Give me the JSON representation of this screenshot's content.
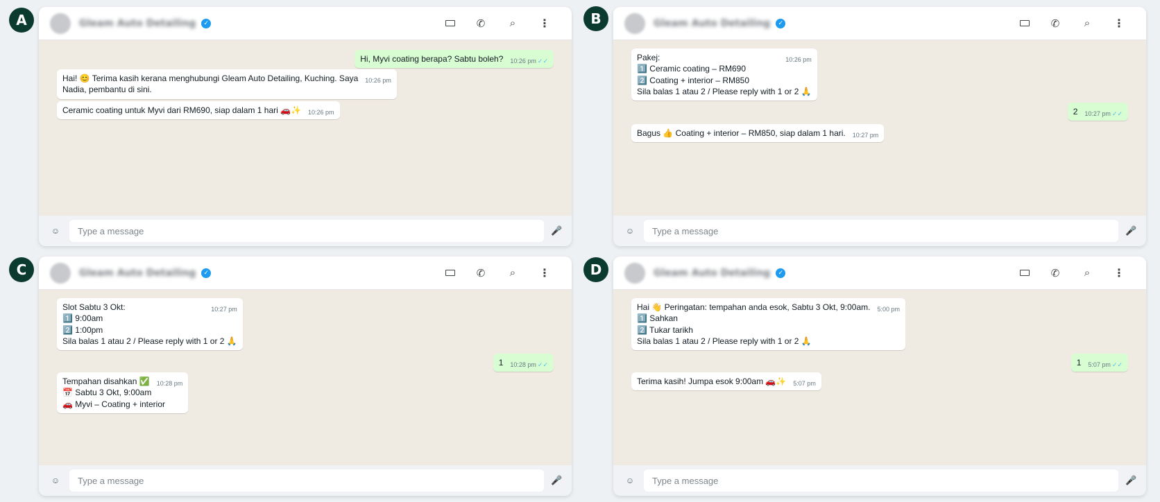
{
  "colors": {
    "label_bg": "#0b3b2e",
    "chat_bg": "#efeae2",
    "outgoing_bubble": "#d9fdd3",
    "incoming_bubble": "#ffffff",
    "verified_badge": "#1d9bf0",
    "read_ticks": "#53bdeb"
  },
  "icons": {
    "video": "video-icon",
    "call": "phone-icon",
    "search": "search-icon",
    "menu": "kebab-menu-icon",
    "emoji": "emoji-icon",
    "mic": "mic-icon",
    "verified": "verified-check-icon"
  },
  "glyphs": {
    "call": "✆",
    "search": "⌕",
    "menu": "⋮",
    "emoji": "☺",
    "mic": "🎤",
    "verified": "✓",
    "ticks": "✓✓"
  },
  "contact": {
    "name": "Gleam Auto Detailing"
  },
  "composer": {
    "placeholder": "Type a message"
  },
  "panels": [
    {
      "label": "A",
      "messages": [
        {
          "dir": "out",
          "text": "Hi, Myvi coating berapa? Sabtu boleh?",
          "time": "10:26 pm"
        },
        {
          "dir": "in",
          "text": "Hai! 😊 Terima kasih kerana menghubungi Gleam Auto Detailing, Kuching. Saya\nNadia, pembantu di sini.",
          "time": "10:26 pm"
        },
        {
          "dir": "in",
          "text": "Ceramic coating untuk Myvi dari RM690, siap dalam 1 hari 🚗✨",
          "time": "10:26 pm"
        }
      ]
    },
    {
      "label": "B",
      "messages": [
        {
          "dir": "in",
          "text": "Pakej:\n1️⃣ Ceramic coating – RM690\n2️⃣ Coating + interior – RM850\nSila balas 1 atau 2 / Please reply with 1 or 2 🙏",
          "time": "10:26 pm"
        },
        {
          "dir": "out",
          "text": "2",
          "time": "10:27 pm"
        },
        {
          "dir": "in",
          "text": "Bagus 👍 Coating + interior – RM850, siap dalam 1 hari.",
          "time": "10:27 pm"
        }
      ]
    },
    {
      "label": "C",
      "messages": [
        {
          "dir": "in",
          "text": "Slot Sabtu 3 Okt:\n1️⃣ 9:00am\n2️⃣ 1:00pm\nSila balas 1 atau 2 / Please reply with 1 or 2 🙏",
          "time": "10:27 pm"
        },
        {
          "dir": "out",
          "text": "1",
          "time": "10:28 pm"
        },
        {
          "dir": "in",
          "text": "Tempahan disahkan ✅\n📅 Sabtu 3 Okt, 9:00am\n🚗 Myvi – Coating + interior",
          "time": "10:28 pm"
        }
      ]
    },
    {
      "label": "D",
      "messages": [
        {
          "dir": "in",
          "text": "Hai 👋 Peringatan: tempahan anda esok, Sabtu 3 Okt, 9:00am.\n1️⃣ Sahkan\n2️⃣ Tukar tarikh\nSila balas 1 atau 2 / Please reply with 1 or 2 🙏",
          "time": "5:00 pm"
        },
        {
          "dir": "out",
          "text": "1",
          "time": "5:07 pm"
        },
        {
          "dir": "in",
          "text": "Terima kasih! Jumpa esok 9:00am 🚗✨",
          "time": "5:07 pm"
        }
      ]
    }
  ]
}
